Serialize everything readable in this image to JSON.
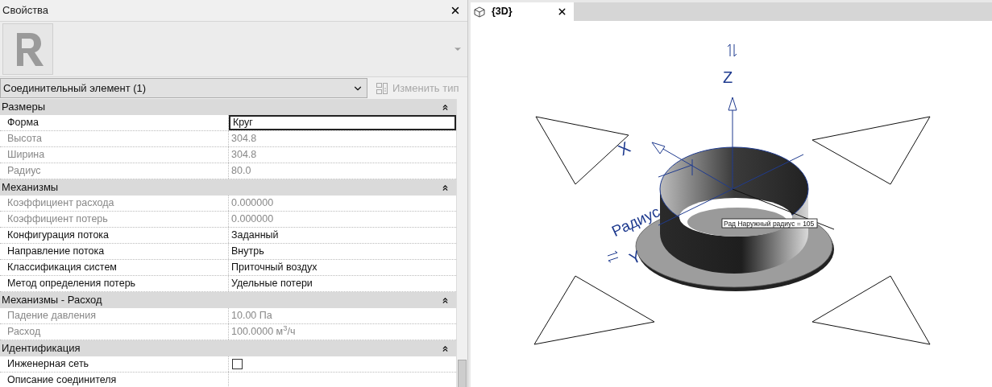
{
  "properties": {
    "title": "Свойства",
    "type_selector": "Соединительный элемент (1)",
    "edit_type_button": {
      "label": "Изменить тип",
      "disabled": true
    },
    "rows": [
      {
        "kind": "section",
        "label": "Размеры",
        "expanded": true
      },
      {
        "kind": "text",
        "label": "Форма",
        "value": "Круг",
        "disabled": false,
        "selected": true
      },
      {
        "kind": "text",
        "label": "Высота",
        "value": "304.8",
        "disabled": true,
        "selected": false
      },
      {
        "kind": "text",
        "label": "Ширина",
        "value": "304.8",
        "disabled": true,
        "selected": false
      },
      {
        "kind": "text",
        "label": "Радиус",
        "value": "80.0",
        "disabled": true,
        "selected": false
      },
      {
        "kind": "section",
        "label": "Механизмы",
        "expanded": true
      },
      {
        "kind": "text",
        "label": "Коэффициент расхода",
        "value": "0.000000",
        "disabled": true,
        "selected": false
      },
      {
        "kind": "text",
        "label": "Коэффициент потерь",
        "value": "0.000000",
        "disabled": true,
        "selected": false
      },
      {
        "kind": "text",
        "label": "Конфигурация потока",
        "value": "Заданный",
        "disabled": false,
        "selected": false
      },
      {
        "kind": "text",
        "label": "Направление потока",
        "value": "Внутрь",
        "disabled": false,
        "selected": false
      },
      {
        "kind": "text",
        "label": "Классификация систем",
        "value": "Приточный воздух",
        "disabled": false,
        "selected": false
      },
      {
        "kind": "text",
        "label": "Метод определения потерь",
        "value": "Удельные потери",
        "disabled": false,
        "selected": false
      },
      {
        "kind": "section",
        "label": "Механизмы - Расход",
        "expanded": true
      },
      {
        "kind": "text",
        "label": "Падение давления",
        "value": "10.00 Па",
        "disabled": true,
        "selected": false
      },
      {
        "kind": "text",
        "label": "Расход",
        "value": "100.0000 м$^{3}$/ч",
        "disabled": true,
        "selected": false
      },
      {
        "kind": "section",
        "label": "Идентификация",
        "expanded": true
      },
      {
        "kind": "checkbox",
        "label": "Инженерная сеть",
        "checked": false,
        "disabled": false,
        "selected": false
      },
      {
        "kind": "text",
        "label": "Описание соединителя",
        "disabled": false,
        "selected": false
      }
    ]
  },
  "view": {
    "tab": {
      "label": "{3D}",
      "selected": true
    },
    "labels": {
      "z": "Z",
      "x": "X",
      "y": "Y",
      "radius": "Радиус",
      "dimension": "Рад Наружный радиус = 105"
    }
  }
}
